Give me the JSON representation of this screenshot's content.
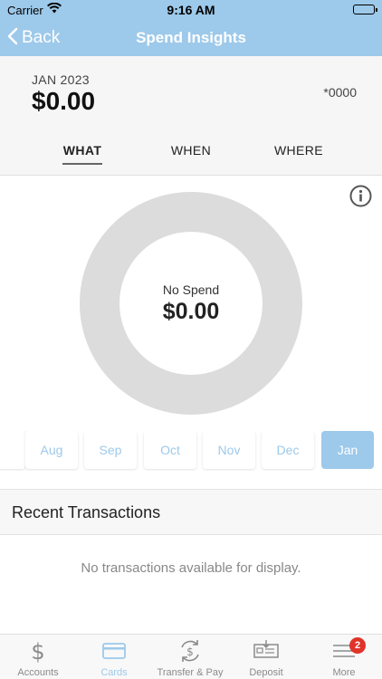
{
  "status_bar": {
    "carrier": "Carrier",
    "time": "9:16 AM"
  },
  "nav": {
    "back_label": "Back",
    "title": "Spend Insights"
  },
  "summary": {
    "period": "JAN 2023",
    "amount": "$0.00",
    "card_mask": "*0000"
  },
  "tabs": [
    {
      "label": "WHAT",
      "active": true
    },
    {
      "label": "WHEN",
      "active": false
    },
    {
      "label": "WHERE",
      "active": false
    }
  ],
  "chart": {
    "center_label": "No Spend",
    "center_value": "$0.00",
    "ring_color": "#dcdcdc"
  },
  "chart_data": {
    "type": "pie",
    "title": "",
    "categories": [],
    "values": []
  },
  "months": [
    {
      "label": "Aug",
      "active": false
    },
    {
      "label": "Sep",
      "active": false
    },
    {
      "label": "Oct",
      "active": false
    },
    {
      "label": "Nov",
      "active": false
    },
    {
      "label": "Dec",
      "active": false
    },
    {
      "label": "Jan",
      "active": true
    }
  ],
  "recent": {
    "title": "Recent Transactions",
    "empty_message": "No transactions available for display."
  },
  "tab_bar": {
    "items": [
      {
        "label": "Accounts",
        "icon": "dollar-icon",
        "active": false
      },
      {
        "label": "Cards",
        "icon": "card-icon",
        "active": true
      },
      {
        "label": "Transfer & Pay",
        "icon": "transfer-icon",
        "active": false
      },
      {
        "label": "Deposit",
        "icon": "deposit-check-icon",
        "active": false
      },
      {
        "label": "More",
        "icon": "menu-icon",
        "active": false
      }
    ],
    "more_badge": "2"
  },
  "colors": {
    "accent": "#9dc9ea",
    "badge": "#e0342a",
    "summary_bg": "#f6f6f6"
  }
}
